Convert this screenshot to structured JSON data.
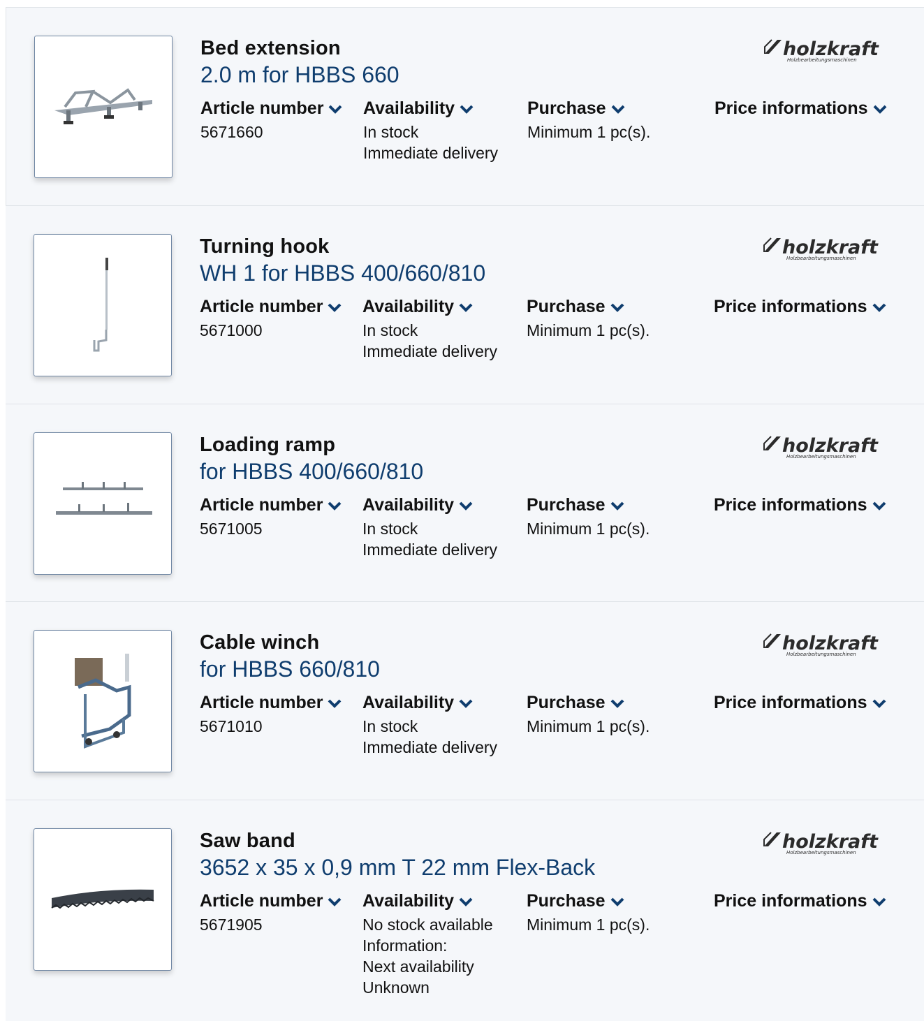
{
  "brand": {
    "logo_text": "holzkraft",
    "logo_subtext": "Holzbearbeitungsmaschinen"
  },
  "labels": {
    "article_number": "Article number",
    "availability": "Availability",
    "purchase": "Purchase",
    "price_info": "Price informations"
  },
  "colors": {
    "accent": "#0f3d6e",
    "row_bg": "#f5f7fa",
    "border": "#dfe3e8"
  },
  "products": [
    {
      "title": "Bed extension",
      "subtitle": "2.0 m for HBBS 660",
      "article": "5671660",
      "availability": [
        "In stock",
        "Immediate delivery"
      ],
      "purchase": "Minimum 1 pc(s).",
      "image": "bed-extension-image"
    },
    {
      "title": "Turning hook",
      "subtitle": "WH 1 for HBBS 400/660/810",
      "article": "5671000",
      "availability": [
        "In stock",
        "Immediate delivery"
      ],
      "purchase": "Minimum 1 pc(s).",
      "image": "turning-hook-image"
    },
    {
      "title": "Loading ramp",
      "subtitle": "for HBBS 400/660/810",
      "article": "5671005",
      "availability": [
        "In stock",
        "Immediate delivery"
      ],
      "purchase": "Minimum 1 pc(s).",
      "image": "loading-ramp-image"
    },
    {
      "title": "Cable winch",
      "subtitle": "for HBBS 660/810",
      "article": "5671010",
      "availability": [
        "In stock",
        "Immediate delivery"
      ],
      "purchase": "Minimum 1 pc(s).",
      "image": "cable-winch-image"
    },
    {
      "title": "Saw band",
      "subtitle": "3652 x 35 x 0,9 mm T 22 mm Flex-Back",
      "article": "5671905",
      "availability": [
        "No stock available",
        "Information:",
        "Next availability",
        "Unknown"
      ],
      "purchase": "Minimum 1 pc(s).",
      "image": "saw-band-image"
    }
  ]
}
